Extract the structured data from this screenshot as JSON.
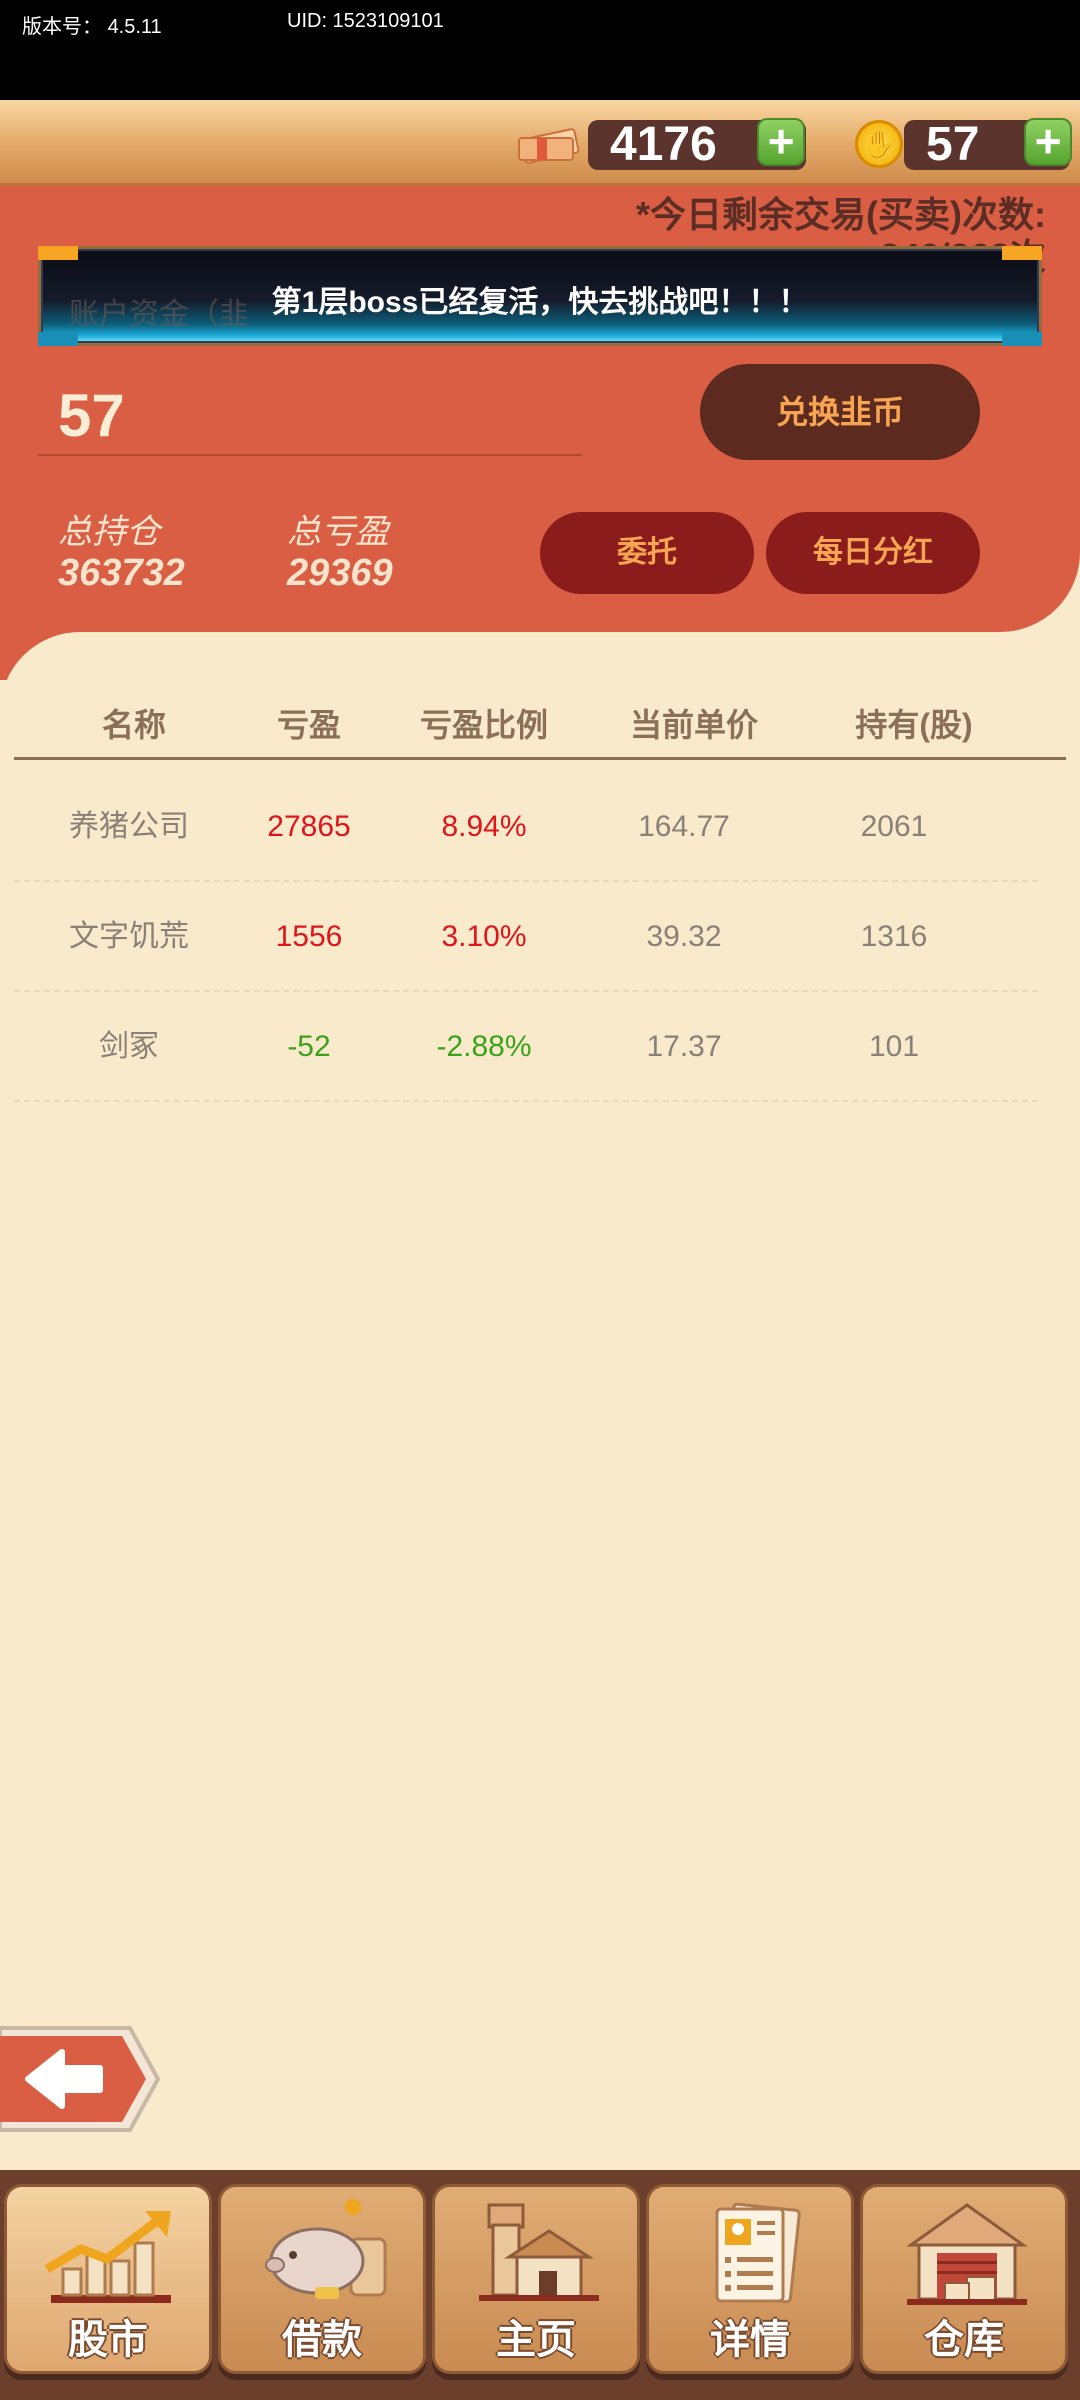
{
  "status": {
    "version_label": "版本号：",
    "version": "4.5.11",
    "uid": "UID: 1523109101"
  },
  "currency": {
    "cash": "4176",
    "coins": "57",
    "cash_icon": "cash-bundle-icon",
    "coin_icon": "gold-coin-icon"
  },
  "panel": {
    "trade_count_line1": "*今日剩余交易(买卖)次数:",
    "trade_count_line2": "240/268次",
    "banner_text": "第1层boss已经复活，快去挑战吧！！！",
    "banner_faded": "账户资金（韭",
    "balance": "57",
    "exchange_button": "兑换韭币",
    "total_position_label": "总持仓",
    "total_position_value": "363732",
    "total_pnl_label": "总亏盈",
    "total_pnl_value": "29369",
    "entrust_button": "委托",
    "dividend_button": "每日分红"
  },
  "table": {
    "headers": [
      "名称",
      "亏盈",
      "亏盈比例",
      "当前单价",
      "持有(股)"
    ],
    "rows": [
      {
        "name": "养猪公司",
        "pnl": "27865",
        "ratio": "8.94%",
        "price": "164.77",
        "hold": "2061",
        "sign": "pos"
      },
      {
        "name": "文字饥荒",
        "pnl": "1556",
        "ratio": "3.10%",
        "price": "39.32",
        "hold": "1316",
        "sign": "pos"
      },
      {
        "name": "剑冢",
        "pnl": "-52",
        "ratio": "-2.88%",
        "price": "17.37",
        "hold": "101",
        "sign": "neg"
      }
    ]
  },
  "nav": {
    "items": [
      {
        "label": "股市",
        "icon": "stock-chart-icon"
      },
      {
        "label": "借款",
        "icon": "piggy-bank-icon"
      },
      {
        "label": "主页",
        "icon": "home-icon"
      },
      {
        "label": "详情",
        "icon": "document-icon"
      },
      {
        "label": "仓库",
        "icon": "warehouse-icon"
      }
    ]
  },
  "colors": {
    "panel": "#da5e43",
    "background": "#f8eacb",
    "gain": "#e0151b",
    "loss": "#3aa31a"
  }
}
